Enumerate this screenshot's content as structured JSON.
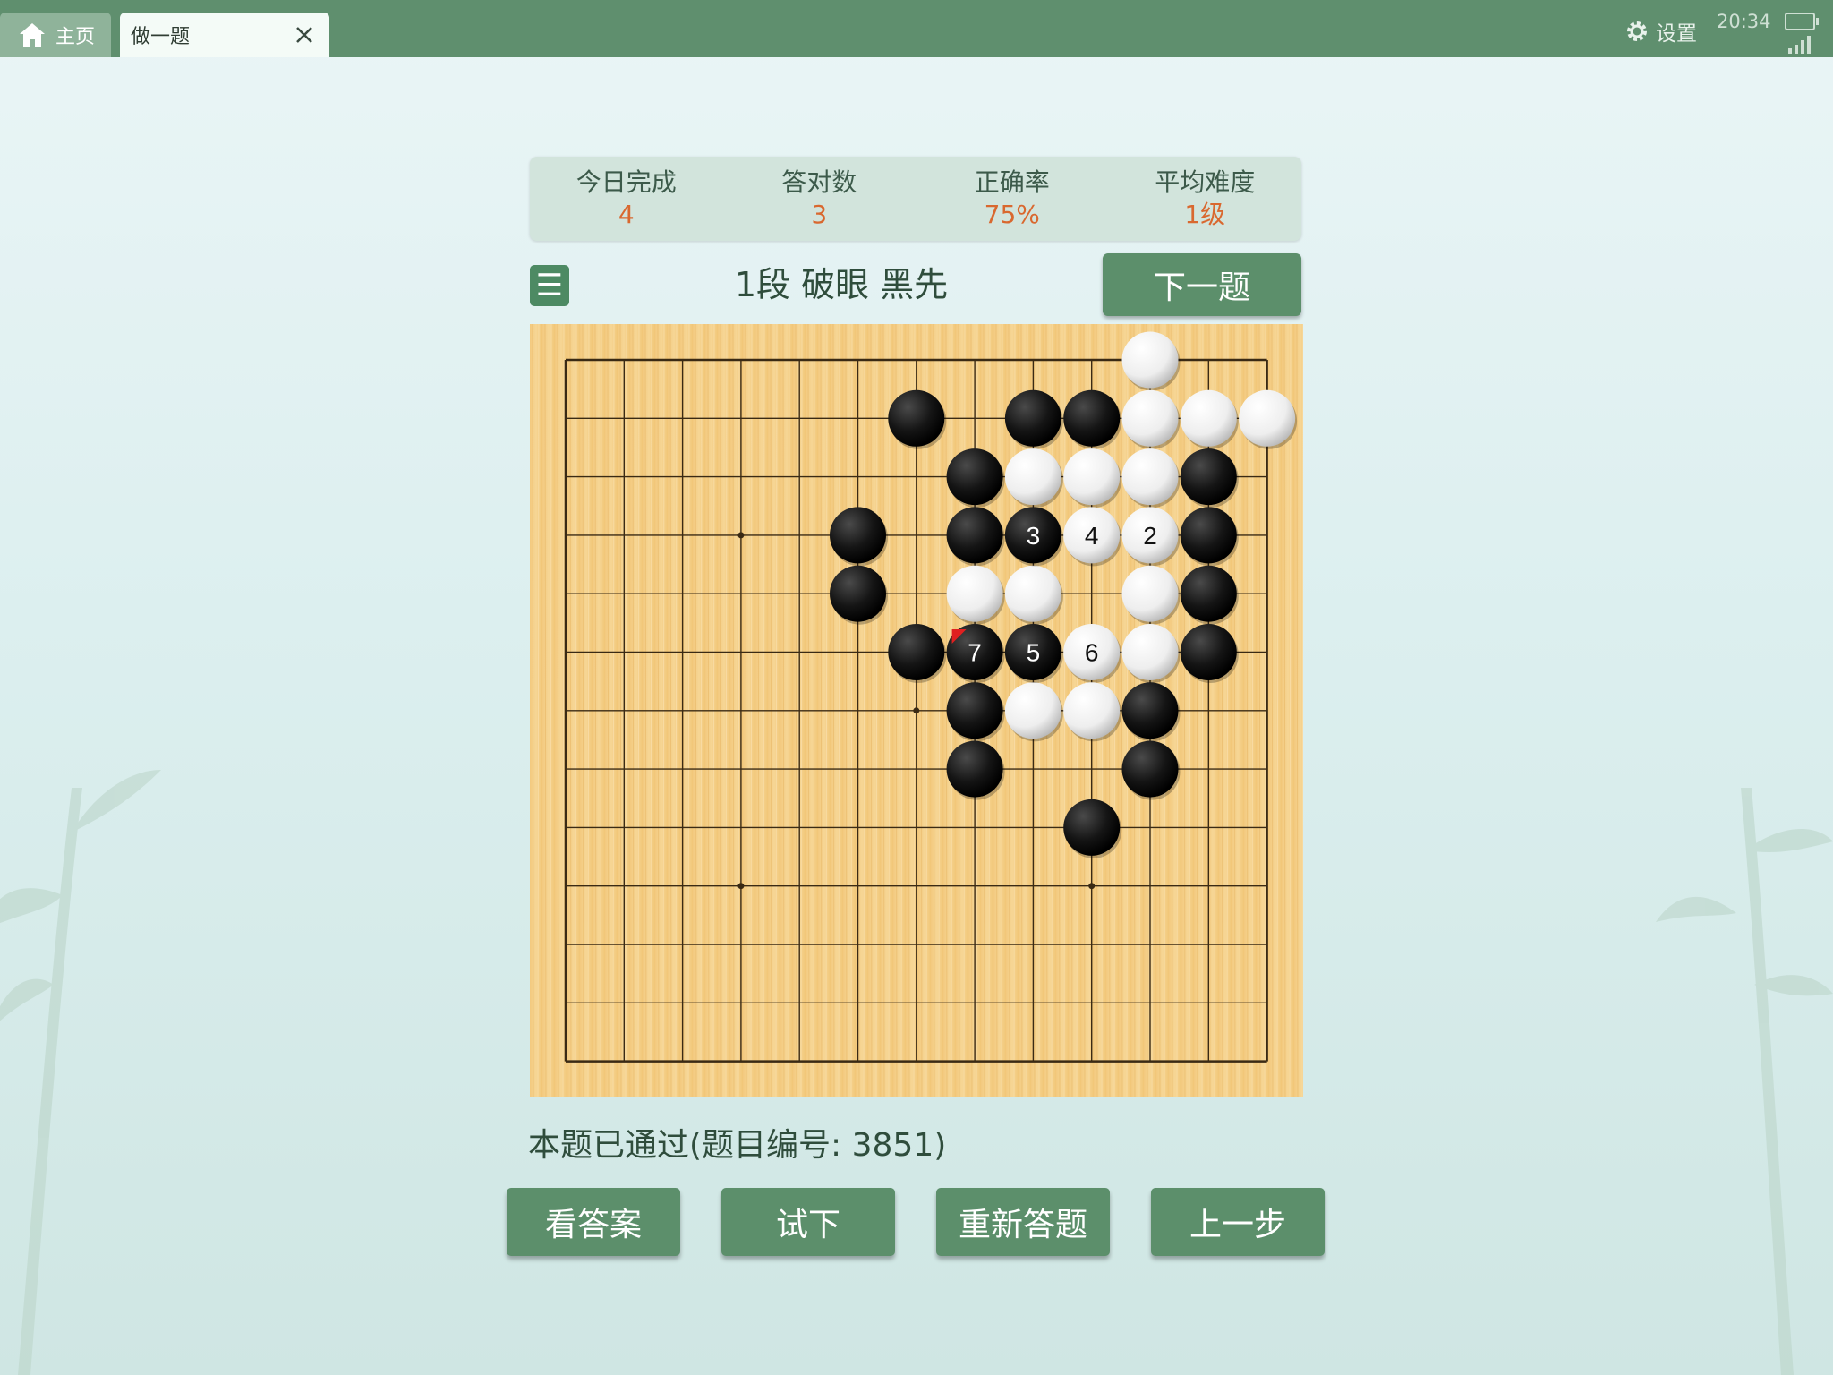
{
  "tabs": [
    {
      "label": "主页",
      "icon": "home-icon"
    },
    {
      "label": "做一题",
      "icon": "close-icon"
    }
  ],
  "status_bar": {
    "settings_label": "设置",
    "time": "20:34"
  },
  "stats": [
    {
      "title": "今日完成",
      "value": "4"
    },
    {
      "title": "答对数",
      "value": "3"
    },
    {
      "title": "正确率",
      "value": "75%"
    },
    {
      "title": "平均难度",
      "value": "1级"
    }
  ],
  "problem": {
    "menu_symbol": "☰",
    "title": "1段 破眼 黑先",
    "next_label": "下一题",
    "status": "本题已通过(题目编号: 3851)"
  },
  "board": {
    "size": 13,
    "star_points": [
      [
        3,
        3
      ],
      [
        9,
        3
      ],
      [
        6,
        6
      ],
      [
        3,
        9
      ],
      [
        9,
        9
      ]
    ],
    "black": [
      [
        6,
        1
      ],
      [
        8,
        1
      ],
      [
        9,
        1
      ],
      [
        7,
        2
      ],
      [
        11,
        2
      ],
      [
        5,
        3
      ],
      [
        7,
        3
      ],
      [
        11,
        3
      ],
      [
        5,
        4
      ],
      [
        11,
        4
      ],
      [
        6,
        5
      ],
      [
        11,
        5
      ],
      [
        7,
        6
      ],
      [
        10,
        6
      ],
      [
        7,
        7
      ],
      [
        10,
        7
      ],
      [
        9,
        8
      ]
    ],
    "white": [
      [
        10,
        0
      ],
      [
        10,
        1
      ],
      [
        11,
        1
      ],
      [
        12,
        1
      ],
      [
        8,
        2
      ],
      [
        9,
        2
      ],
      [
        10,
        2
      ],
      [
        9,
        3
      ],
      [
        10,
        3
      ],
      [
        7,
        4
      ],
      [
        8,
        4
      ],
      [
        10,
        4
      ],
      [
        9,
        5
      ],
      [
        10,
        5
      ],
      [
        8,
        6
      ],
      [
        9,
        6
      ]
    ],
    "black_numbered": [
      [
        8,
        3,
        "3"
      ],
      [
        7,
        5,
        "7"
      ],
      [
        8,
        5,
        "5"
      ]
    ],
    "white_numbered": [
      [
        9,
        3,
        "4"
      ],
      [
        10,
        3,
        "2"
      ],
      [
        9,
        5,
        "6"
      ]
    ],
    "last_move_marker": [
      7,
      5
    ]
  },
  "buttons": [
    {
      "label": "看答案"
    },
    {
      "label": "试下"
    },
    {
      "label": "重新答题"
    },
    {
      "label": "上一步"
    }
  ]
}
